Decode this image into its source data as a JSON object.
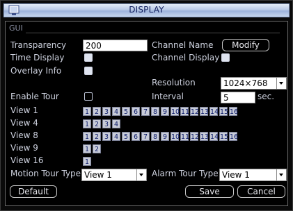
{
  "window": {
    "title": "DISPLAY"
  },
  "section": {
    "gui_label": "GUI"
  },
  "labels": {
    "transparency": "Transparency",
    "time_display": "Time Display",
    "overlay_info": "Overlay Info",
    "channel_name": "Channel Name",
    "channel_display": "Channel Display",
    "resolution": "Resolution",
    "enable_tour": "Enable Tour",
    "interval": "Interval",
    "interval_unit": "sec.",
    "motion_tour_type": "Motion Tour Type",
    "alarm_tour_type": "Alarm Tour Type"
  },
  "values": {
    "transparency": "200",
    "resolution": "1024×768",
    "interval": "5",
    "motion_tour_type": "View 1",
    "alarm_tour_type": "View 1"
  },
  "buttons": {
    "modify": "Modify",
    "default": "Default",
    "save": "Save",
    "cancel": "Cancel"
  },
  "views": [
    {
      "label": "View 1",
      "channels": [
        "1",
        "2",
        "3",
        "4",
        "5",
        "6",
        "7",
        "8",
        "9",
        "10",
        "11",
        "12",
        "13",
        "14",
        "15",
        "16"
      ]
    },
    {
      "label": "View 4",
      "channels": [
        "1",
        "2",
        "3",
        "4"
      ]
    },
    {
      "label": "View 8",
      "channels": [
        "1",
        "2",
        "3",
        "4",
        "5",
        "6",
        "7",
        "8",
        "9",
        "10",
        "11",
        "12",
        "13",
        "14",
        "15",
        "16"
      ]
    },
    {
      "label": "View 9",
      "channels": [
        "1",
        "2"
      ]
    },
    {
      "label": "View 16",
      "channels": [
        "1"
      ]
    }
  ],
  "checkboxes": {
    "time_display": "filled",
    "overlay_info": "filled",
    "channel_display": "filled",
    "enable_tour": "empty"
  },
  "colors": {
    "title_bar": "#b9c9e6",
    "title_text": "#0f1d5c",
    "label_text": "#cdd1de",
    "channel_button": "#c8ccd8"
  },
  "icons": {
    "title": "monitor-icon"
  }
}
